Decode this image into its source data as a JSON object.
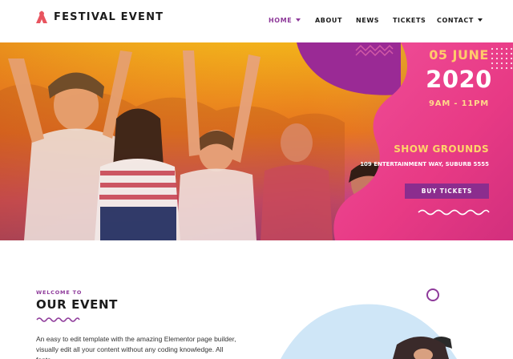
{
  "header": {
    "logo_text": "FESTIVAL EVENT",
    "logo_icon": "festival-logo-icon",
    "nav": [
      {
        "label": "HOME",
        "active": true,
        "dropdown": true
      },
      {
        "label": "ABOUT",
        "active": false,
        "dropdown": false
      },
      {
        "label": "NEWS",
        "active": false,
        "dropdown": false
      },
      {
        "label": "TICKETS",
        "active": false,
        "dropdown": false
      },
      {
        "label": "CONTACT",
        "active": false,
        "dropdown": true
      }
    ]
  },
  "hero": {
    "date": "05 JUNE",
    "year": "2020",
    "time": "9AM - 11PM",
    "venue": "SHOW GROUNDS",
    "address": "109 ENTERTAINMENT WAY, SUBURB 5555",
    "cta_label": "BUY TICKETS"
  },
  "section": {
    "eyebrow": "WELCOME TO",
    "title": "OUR EVENT",
    "body": "An easy to edit template with the amazing Elementor page builder, visually edit all your content without any coding knowledge. All fonts,"
  },
  "colors": {
    "accent": "#8e3a9a",
    "pink": "#e93a8e",
    "yellow": "#ffcb6b",
    "dark": "#1b1b1b"
  }
}
